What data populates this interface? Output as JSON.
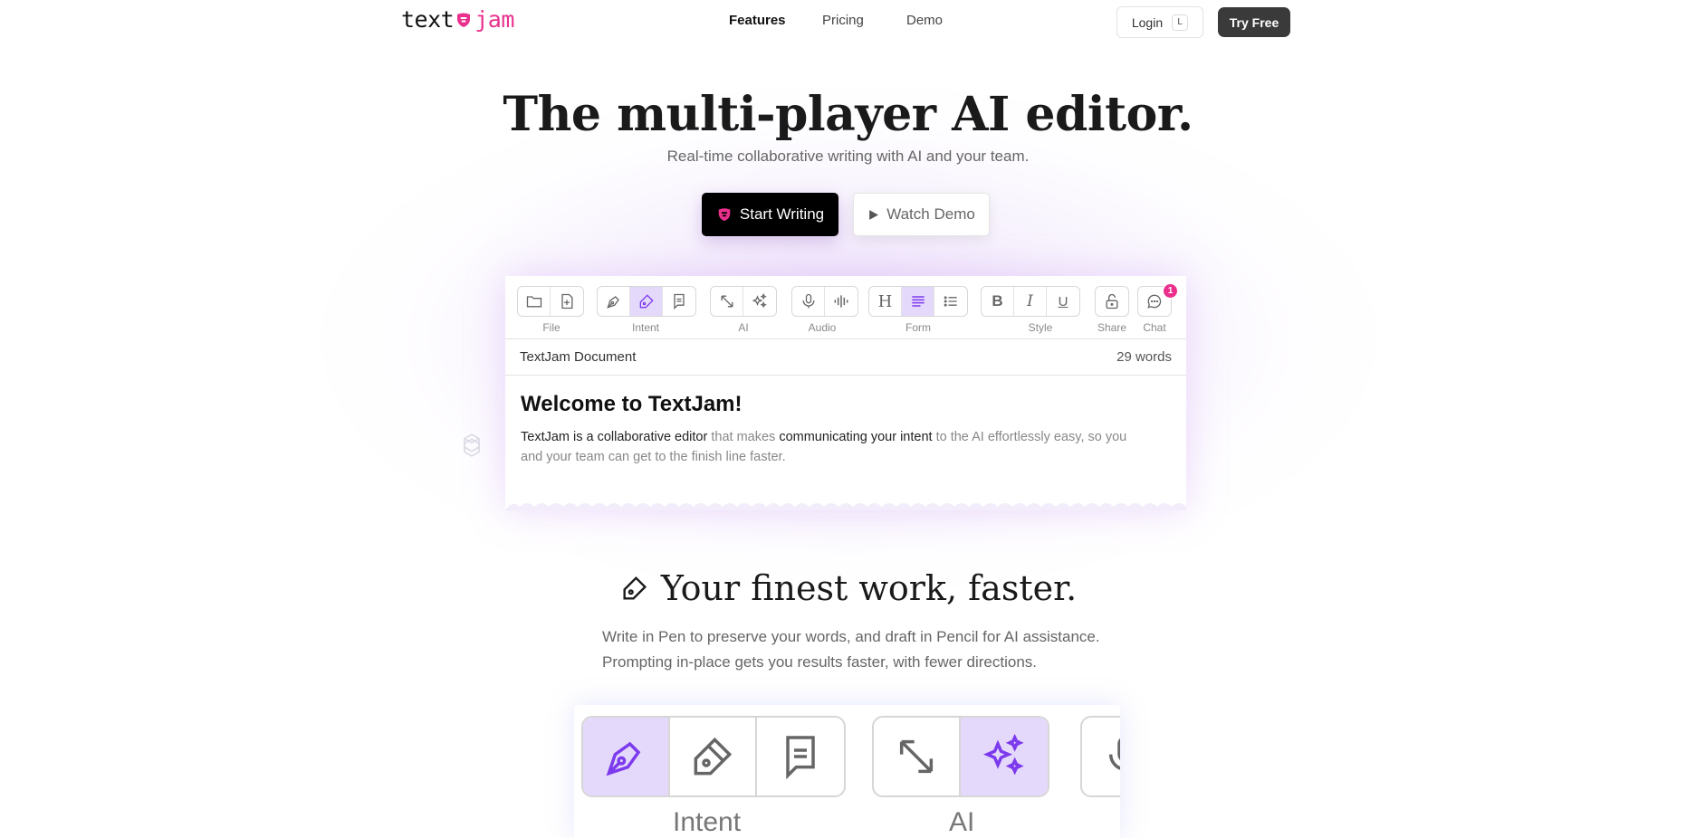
{
  "brand": {
    "text1": "text",
    "text2": "jam",
    "accent": "#e9308c"
  },
  "nav": {
    "links": [
      "Features",
      "Pricing",
      "Demo"
    ],
    "login_label": "Login",
    "login_shortcut": "L",
    "try_label": "Try Free"
  },
  "hero": {
    "title": "The multi-player AI editor.",
    "subtitle": "Real-time collaborative writing with AI and your team.",
    "start_label": "Start Writing",
    "watch_label": "Watch Demo"
  },
  "editor": {
    "toolbar_groups": [
      {
        "label": "File",
        "icons": [
          "folder-icon",
          "new-file-icon"
        ]
      },
      {
        "label": "Intent",
        "icons": [
          "pen-icon",
          "pencil-icon",
          "comment-icon"
        ],
        "active": "pencil-icon"
      },
      {
        "label": "AI",
        "icons": [
          "expand-arrow-icon",
          "sparkles-icon"
        ]
      },
      {
        "label": "Audio",
        "icons": [
          "microphone-icon",
          "waveform-icon"
        ]
      },
      {
        "label": "Form",
        "icons": [
          "heading-icon",
          "paragraph-icon",
          "list-icon"
        ],
        "active": "paragraph-icon"
      },
      {
        "label": "Style",
        "icons": [
          "bold-icon",
          "italic-icon",
          "underline-icon"
        ]
      },
      {
        "label": "Share",
        "icons": [
          "lock-icon"
        ]
      },
      {
        "label": "Chat",
        "icons": [
          "chat-icon"
        ],
        "badge": "1"
      }
    ],
    "doc_title": "TextJam Document",
    "word_count": "29 words",
    "heading": "Welcome to TextJam!",
    "body": {
      "part1": "TextJam is a collaborative editor",
      "part2": " that makes ",
      "part3": "communicating your intent",
      "part4": " to the AI effortlessly easy, so you and your team can get to the finish line faster."
    }
  },
  "section2": {
    "title": "Your finest work, faster.",
    "line1": "Write in Pen to preserve your words, and draft in Pencil for AI assistance.",
    "line2": "Prompting in-place gets you results faster, with fewer directions.",
    "intent_label": "Intent",
    "ai_label": "AI"
  },
  "colors": {
    "accent_purple": "#7c3aed",
    "active_bg": "#e5d9fb",
    "dark_button": "#3a3a3a"
  }
}
